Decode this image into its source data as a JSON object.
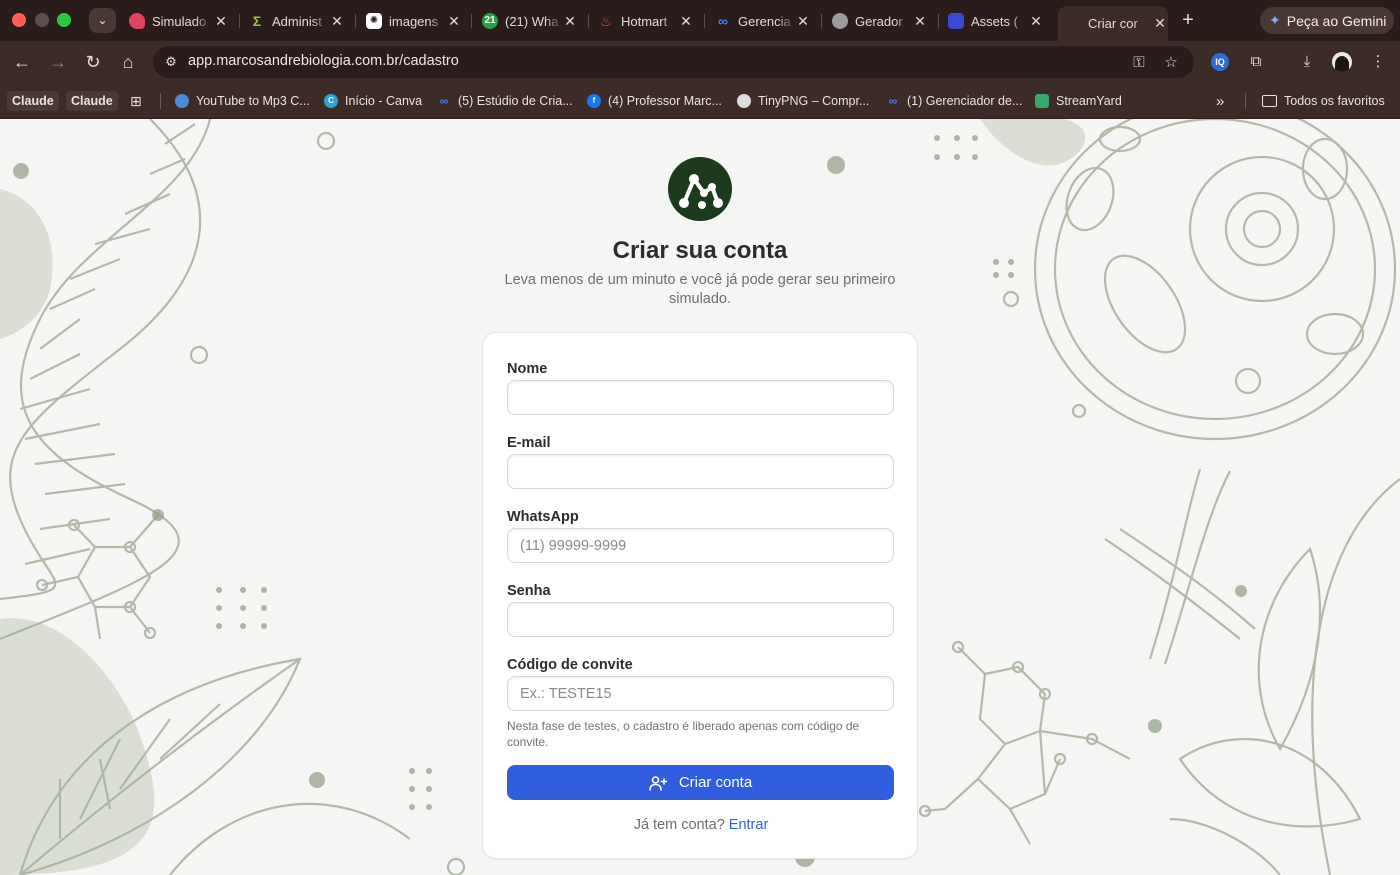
{
  "browser": {
    "tabs": [
      {
        "title": "Simulado",
        "favicon_color": "#e0455f"
      },
      {
        "title": "Administ",
        "favicon_color": "#9bc53d"
      },
      {
        "title": "imagens",
        "favicon_color": "#ffffff"
      },
      {
        "title": "(21) Wha",
        "favicon_color": "#25a244",
        "badge": "21"
      },
      {
        "title": "Hotmart",
        "favicon_color": "#f04e23"
      },
      {
        "title": "Gerencia",
        "favicon_color": "#4a7cf6"
      },
      {
        "title": "Gerador",
        "favicon_color": "#9a9a9a"
      },
      {
        "title": "Assets (",
        "favicon_color": "#3a4ad6"
      },
      {
        "title": "Criar cor",
        "favicon_color": "#3d2b28",
        "active": true
      }
    ],
    "gemini_label": "Peça ao Gemini",
    "url": "app.marcosandrebiologia.com.br/cadastro",
    "bookmarks": [
      {
        "label": "Claude",
        "chip": true
      },
      {
        "label": "Claude",
        "chip": true
      },
      {
        "label": "YouTube to Mp3 C...",
        "favicon_color": "#4a8ad6"
      },
      {
        "label": "Início - Canva",
        "favicon_color": "#2aa5d6"
      },
      {
        "label": "(5) Estúdio de Cria...",
        "favicon_color": "#4a7cf6"
      },
      {
        "label": "(4) Professor Marc...",
        "favicon_color": "#1877f2"
      },
      {
        "label": "TinyPNG – Compr...",
        "favicon_color": "#dddddd"
      },
      {
        "label": "(1) Gerenciador de...",
        "favicon_color": "#4a7cf6"
      },
      {
        "label": "StreamYard",
        "favicon_color": "#39a86c"
      }
    ],
    "all_bookmarks_label": "Todos os favoritos"
  },
  "signup": {
    "title": "Criar sua conta",
    "subtitle": "Leva menos de um minuto e você já pode gerar seu primeiro simulado.",
    "fields": {
      "name": {
        "label": "Nome",
        "value": "",
        "placeholder": ""
      },
      "email": {
        "label": "E-mail",
        "value": "",
        "placeholder": ""
      },
      "whatsapp": {
        "label": "WhatsApp",
        "value": "",
        "placeholder": "(11) 99999-9999"
      },
      "password": {
        "label": "Senha",
        "value": "",
        "placeholder": ""
      },
      "invite": {
        "label": "Código de convite",
        "value": "",
        "placeholder": "Ex.: TESTE15"
      }
    },
    "invite_hint": "Nesta fase de testes, o cadastro é liberado apenas com código de convite.",
    "submit_label": "Criar conta",
    "login_prompt": "Já tem conta?",
    "login_link": "Entrar",
    "colors": {
      "primary": "#2f5fdf",
      "logo": "#1c3a1c",
      "decor": "#8e9c84"
    }
  }
}
